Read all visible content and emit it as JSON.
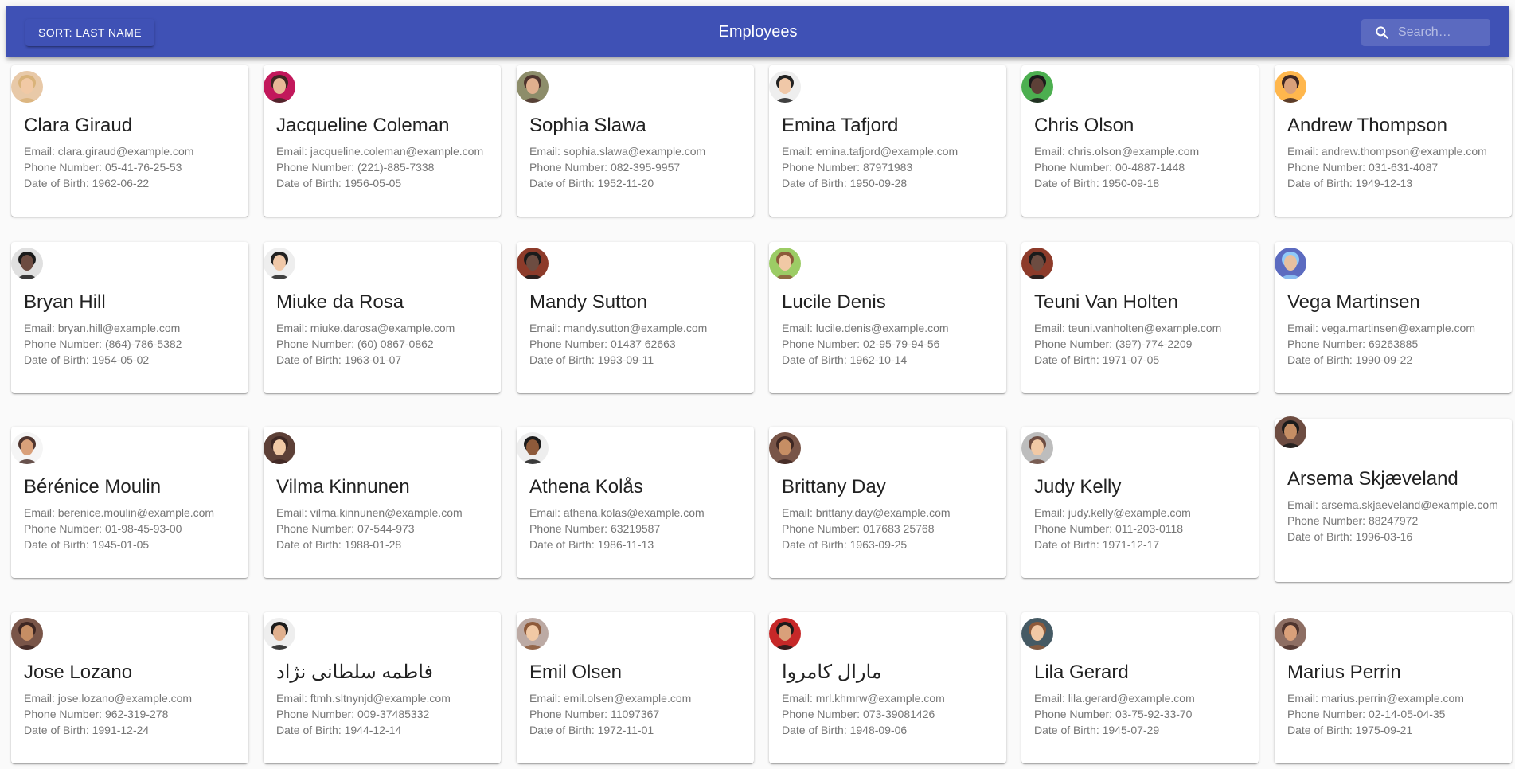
{
  "header": {
    "sort_label": "SORT: LAST NAME",
    "title": "Employees",
    "search_placeholder": "Search…",
    "search_value": ""
  },
  "labels": {
    "email": "Email:",
    "phone": "Phone Number:",
    "dob": "Date of Birth:"
  },
  "colors": {
    "primary": "#3f51b5",
    "secondary_text": "#757575"
  },
  "employees": [
    {
      "name": "Clara Giraud",
      "email": "clara.giraud@example.com",
      "phone": "05-41-76-25-53",
      "dob": "1962-06-22",
      "avatar": {
        "bg": "#e8c9a8",
        "skin": "#f1c9a5",
        "hair": "#d9b37a"
      }
    },
    {
      "name": "Jacqueline Coleman",
      "email": "jacqueline.coleman@example.com",
      "phone": "(221)-885-7338",
      "dob": "1956-05-05",
      "avatar": {
        "bg": "#c2185b",
        "skin": "#e8b896",
        "hair": "#3e2723"
      }
    },
    {
      "name": "Sophia Slawa",
      "email": "sophia.slawa@example.com",
      "phone": "082-395-9957",
      "dob": "1952-11-20",
      "avatar": {
        "bg": "#8d8d6a",
        "skin": "#e0b08e",
        "hair": "#4e342e"
      }
    },
    {
      "name": "Emina Tafjord",
      "email": "emina.tafjord@example.com",
      "phone": "87971983",
      "dob": "1950-09-28",
      "avatar": {
        "bg": "#eeeeee",
        "skin": "#f0c8a8",
        "hair": "#212121"
      }
    },
    {
      "name": "Chris Olson",
      "email": "chris.olson@example.com",
      "phone": "00-4887-1448",
      "dob": "1950-09-18",
      "avatar": {
        "bg": "#4caf50",
        "skin": "#5d4037",
        "hair": "#1b1b1b"
      }
    },
    {
      "name": "Andrew Thompson",
      "email": "andrew.thompson@example.com",
      "phone": "031-631-4087",
      "dob": "1949-12-13",
      "avatar": {
        "bg": "#ffb74d",
        "skin": "#d9a07a",
        "hair": "#3e2723"
      }
    },
    {
      "name": "Bryan Hill",
      "email": "bryan.hill@example.com",
      "phone": "(864)-786-5382",
      "dob": "1954-05-02",
      "avatar": {
        "bg": "#e0e0e0",
        "skin": "#6d4c41",
        "hair": "#1b1b1b"
      }
    },
    {
      "name": "Miuke da Rosa",
      "email": "miuke.darosa@example.com",
      "phone": "(60) 0867-0862",
      "dob": "1963-01-07",
      "avatar": {
        "bg": "#eeeeee",
        "skin": "#f0c8a8",
        "hair": "#212121"
      }
    },
    {
      "name": "Mandy Sutton",
      "email": "mandy.sutton@example.com",
      "phone": "01437 62663",
      "dob": "1993-09-11",
      "avatar": {
        "bg": "#8d3b2a",
        "skin": "#6d4c41",
        "hair": "#1b1b1b"
      }
    },
    {
      "name": "Lucile Denis",
      "email": "lucile.denis@example.com",
      "phone": "02-95-79-94-56",
      "dob": "1962-10-14",
      "avatar": {
        "bg": "#9ccc65",
        "skin": "#f1c9a5",
        "hair": "#8d5a3a"
      }
    },
    {
      "name": "Teuni Van Holten",
      "email": "teuni.vanholten@example.com",
      "phone": "(397)-774-2209",
      "dob": "1971-07-05",
      "avatar": {
        "bg": "#8d3b2a",
        "skin": "#6d4c41",
        "hair": "#1b1b1b"
      }
    },
    {
      "name": "Vega Martinsen",
      "email": "vega.martinsen@example.com",
      "phone": "69263885",
      "dob": "1990-09-22",
      "avatar": {
        "bg": "#5c6bc0",
        "skin": "#e8c0a0",
        "hair": "#90caf9"
      }
    },
    {
      "name": "Bérénice Moulin",
      "email": "berenice.moulin@example.com",
      "phone": "01-98-45-93-00",
      "dob": "1945-01-05",
      "avatar": {
        "bg": "#f5f5f5",
        "skin": "#d9a07a",
        "hair": "#4e342e"
      }
    },
    {
      "name": "Vilma Kinnunen",
      "email": "vilma.kinnunen@example.com",
      "phone": "07-544-973",
      "dob": "1988-01-28",
      "avatar": {
        "bg": "#5d4037",
        "skin": "#f1c9a5",
        "hair": "#3e2723"
      }
    },
    {
      "name": "Athena Kolås",
      "email": "athena.kolas@example.com",
      "phone": "63219587",
      "dob": "1986-11-13",
      "avatar": {
        "bg": "#eeeeee",
        "skin": "#8d5a3a",
        "hair": "#1b1b1b"
      }
    },
    {
      "name": "Brittany Day",
      "email": "brittany.day@example.com",
      "phone": "017683 25768",
      "dob": "1963-09-25",
      "avatar": {
        "bg": "#795548",
        "skin": "#c68e64",
        "hair": "#3e2723"
      }
    },
    {
      "name": "Judy Kelly",
      "email": "judy.kelly@example.com",
      "phone": "011-203-0118",
      "dob": "1971-12-17",
      "avatar": {
        "bg": "#bdbdbd",
        "skin": "#f1c9a5",
        "hair": "#6d4c41"
      }
    },
    {
      "name": "Arsema Skjæveland",
      "email": "arsema.skjaeveland@example.com",
      "phone": "88247972",
      "dob": "1996-03-16",
      "avatar": {
        "bg": "#6d4c41",
        "skin": "#c68e64",
        "hair": "#1b1b1b"
      },
      "email_wrap": true
    },
    {
      "name": "Jose Lozano",
      "email": "jose.lozano@example.com",
      "phone": "962-319-278",
      "dob": "1991-12-24",
      "avatar": {
        "bg": "#795548",
        "skin": "#c68e64",
        "hair": "#3e2723"
      }
    },
    {
      "name": "فاطمه سلطانی نژاد",
      "email": "ftmh.sltnynjd@example.com",
      "phone": "009-37485332",
      "dob": "1944-12-14",
      "avatar": {
        "bg": "#eeeeee",
        "skin": "#e0b08e",
        "hair": "#1b1b1b"
      }
    },
    {
      "name": "Emil Olsen",
      "email": "emil.olsen@example.com",
      "phone": "11097367",
      "dob": "1972-11-01",
      "avatar": {
        "bg": "#bcaaa4",
        "skin": "#f1c9a5",
        "hair": "#8d5a3a"
      }
    },
    {
      "name": "مارال کامروا",
      "email": "mrl.khmrw@example.com",
      "phone": "073-39081426",
      "dob": "1948-09-06",
      "avatar": {
        "bg": "#c62828",
        "skin": "#d9a07a",
        "hair": "#1b1b1b"
      }
    },
    {
      "name": "Lila Gerard",
      "email": "lila.gerard@example.com",
      "phone": "03-75-92-33-70",
      "dob": "1945-07-29",
      "avatar": {
        "bg": "#455a64",
        "skin": "#f1c9a5",
        "hair": "#8d5a3a"
      }
    },
    {
      "name": "Marius Perrin",
      "email": "marius.perrin@example.com",
      "phone": "02-14-05-04-35",
      "dob": "1975-09-21",
      "avatar": {
        "bg": "#8d6e63",
        "skin": "#d9a07a",
        "hair": "#4e342e"
      }
    }
  ]
}
